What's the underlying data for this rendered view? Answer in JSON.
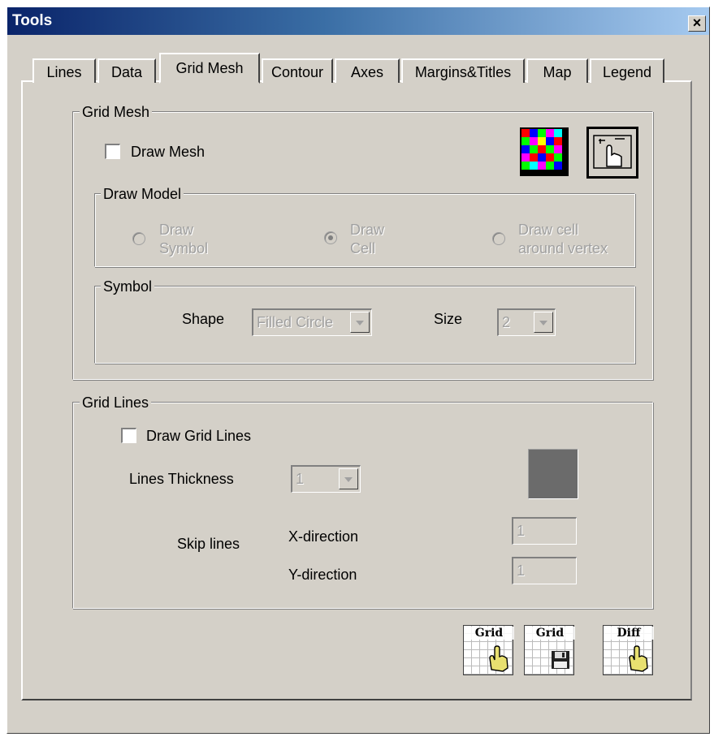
{
  "window": {
    "title": "Tools",
    "close_label": "×"
  },
  "tabs": [
    {
      "label": "Lines"
    },
    {
      "label": "Data"
    },
    {
      "label": "Grid Mesh"
    },
    {
      "label": "Contour"
    },
    {
      "label": "Axes"
    },
    {
      "label": "Margins&Titles"
    },
    {
      "label": "Map"
    },
    {
      "label": "Legend"
    }
  ],
  "active_tab": "Grid Mesh",
  "grid_mesh": {
    "group_label": "Grid Mesh",
    "draw_mesh_label": "Draw Mesh",
    "draw_mesh_checked": false,
    "apply_icon": "apply-hand-icon",
    "palette_icon": "color-palette-icon",
    "draw_model": {
      "group_label": "Draw Model",
      "options": [
        {
          "line1": "Draw",
          "line2": "Symbol",
          "selected": false
        },
        {
          "line1": "Draw",
          "line2": "Cell",
          "selected": true
        },
        {
          "line1": "Draw cell",
          "line2": "around vertex",
          "selected": false
        }
      ]
    },
    "symbol": {
      "group_label": "Symbol",
      "shape_label": "Shape",
      "shape_value": "Filled Circle",
      "size_label": "Size",
      "size_value": "2"
    }
  },
  "grid_lines": {
    "group_label": "Grid Lines",
    "draw_grid_lines_label": "Draw Grid Lines",
    "draw_grid_lines_checked": false,
    "thickness_label": "Lines Thickness",
    "thickness_value": "1",
    "line_color": "#6b6b6b",
    "skip_lines_label": "Skip lines",
    "x_direction_label": "X-direction",
    "x_direction_value": "1",
    "y_direction_label": "Y-direction",
    "y_direction_value": "1"
  },
  "bottom_buttons": [
    {
      "label": "Grid",
      "icon": "hand-pointer-icon"
    },
    {
      "label": "Grid",
      "icon": "floppy-disk-icon"
    },
    {
      "label": "Diff",
      "icon": "hand-pointer-icon"
    }
  ]
}
